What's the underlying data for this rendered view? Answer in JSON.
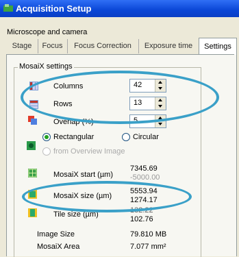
{
  "window": {
    "title": "Acquisition Setup"
  },
  "section_label": "Microscope and camera",
  "tabs": [
    "Stage",
    "Focus",
    "Focus Correction",
    "Exposure time",
    "Settings"
  ],
  "group": {
    "title": "MosaiX settings",
    "columns": {
      "label": "Columns",
      "value": "42"
    },
    "rows": {
      "label": "Rows",
      "value": "13"
    },
    "overlap": {
      "label": "Overlap (%)",
      "value": "5"
    },
    "shape": {
      "rectangular": "Rectangular",
      "circular": "Circular",
      "overview": "from Overview Image"
    },
    "start": {
      "label": "MosaiX start (µm)",
      "v1": "7345.69",
      "v2": "-5000.00"
    },
    "size": {
      "label": "MosaiX size (µm)",
      "v1": "5553.94",
      "v2": "1274.17"
    },
    "tile": {
      "label": "Tile size (µm)",
      "v1": "132.22",
      "v2": "102.76"
    },
    "image_size": {
      "label": "Image Size",
      "value": "79.810 MB"
    },
    "area": {
      "label": "MosaiX Area",
      "value": "7.077 mm²"
    }
  },
  "colors": {
    "annotation": "#3aa0c8",
    "title_bar": "#0a46d6"
  }
}
